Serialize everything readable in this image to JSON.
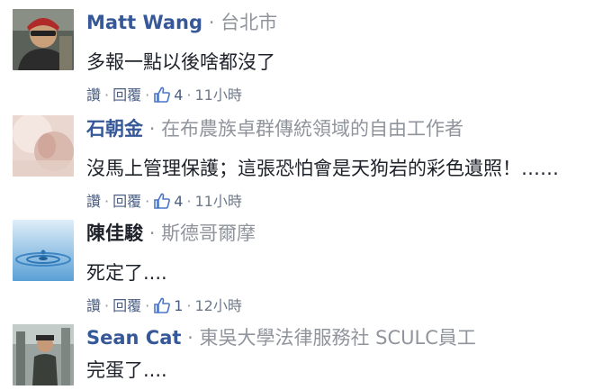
{
  "comments": [
    {
      "author": "Matt Wang",
      "description": "台北市",
      "text": "多報一點以後啥都沒了",
      "reply_actions": [
        "讚",
        "回覆"
      ],
      "likes": "4",
      "time": "11小時"
    },
    {
      "author": "石朝金",
      "description": "在布農族卓群傳統領域的自由工作者",
      "text": "沒馬上管理保護；這張恐怕會是天狗岩的彩色遺照！……",
      "reply_actions": [
        "讚",
        "回覆"
      ],
      "likes": "4",
      "time": "11小時"
    },
    {
      "author": "陳佳駿",
      "description": "斯德哥爾摩",
      "text": "死定了....",
      "reply_actions": [
        "讚",
        "回覆"
      ],
      "likes": "1",
      "time": "12小時"
    },
    {
      "author": "Sean Cat",
      "description": "東吳大學法律服務社 SCULC員工",
      "text": "完蛋了....",
      "reply_actions": [],
      "likes": "",
      "time": ""
    }
  ],
  "separator": "·",
  "icons": {
    "like": "thumbs-up-icon"
  },
  "colors": {
    "author_link": "#365899",
    "meta_gray": "#90949c",
    "action_blue": "#4b5f83"
  }
}
